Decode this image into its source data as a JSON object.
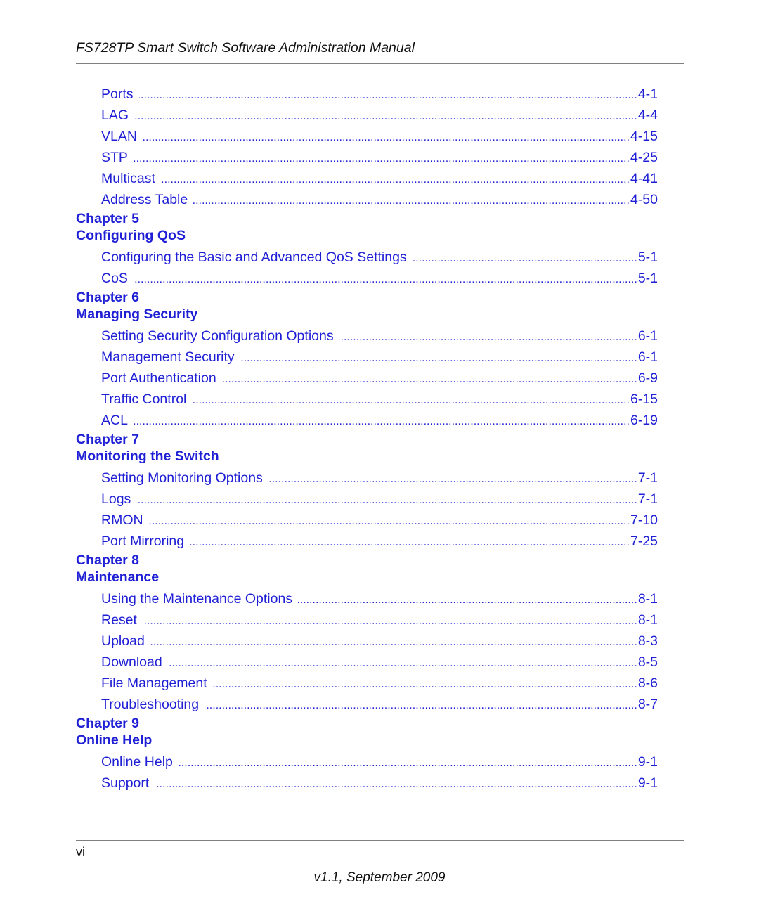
{
  "header": {
    "title": "FS728TP Smart Switch Software Administration Manual"
  },
  "toc": {
    "pre_entries": [
      {
        "label": "Ports",
        "page": "4-1"
      },
      {
        "label": "LAG",
        "page": "4-4"
      },
      {
        "label": "VLAN",
        "page": "4-15"
      },
      {
        "label": "STP",
        "page": "4-25"
      },
      {
        "label": "Multicast",
        "page": "4-41"
      },
      {
        "label": "Address Table",
        "page": "4-50"
      }
    ],
    "chapters": [
      {
        "number": "Chapter 5",
        "title": "Configuring QoS",
        "entries": [
          {
            "label": "Configuring the Basic and Advanced QoS Settings",
            "page": "5-1"
          },
          {
            "label": "CoS",
            "page": "5-1"
          }
        ]
      },
      {
        "number": "Chapter 6",
        "title": "Managing Security",
        "entries": [
          {
            "label": "Setting Security Configuration Options",
            "page": "6-1"
          },
          {
            "label": "Management Security",
            "page": "6-1"
          },
          {
            "label": "Port Authentication",
            "page": "6-9"
          },
          {
            "label": "Traffic Control",
            "page": "6-15"
          },
          {
            "label": "ACL",
            "page": "6-19"
          }
        ]
      },
      {
        "number": "Chapter 7",
        "title": "Monitoring the Switch",
        "entries": [
          {
            "label": "Setting Monitoring Options",
            "page": "7-1"
          },
          {
            "label": "Logs",
            "page": "7-1"
          },
          {
            "label": "RMON",
            "page": "7-10"
          },
          {
            "label": "Port Mirroring",
            "page": "7-25"
          }
        ]
      },
      {
        "number": "Chapter 8",
        "title": "Maintenance",
        "entries": [
          {
            "label": "Using the Maintenance Options",
            "page": "8-1"
          },
          {
            "label": "Reset",
            "page": "8-1"
          },
          {
            "label": "Upload",
            "page": "8-3"
          },
          {
            "label": "Download",
            "page": "8-5"
          },
          {
            "label": "File Management",
            "page": "8-6"
          },
          {
            "label": "Troubleshooting",
            "page": "8-7"
          }
        ]
      },
      {
        "number": "Chapter 9",
        "title": "Online Help",
        "entries": [
          {
            "label": "Online Help",
            "page": "9-1"
          },
          {
            "label": "Support",
            "page": "9-1"
          }
        ]
      }
    ]
  },
  "footer": {
    "page_number": "vi",
    "version": "v1.1, September 2009"
  },
  "colors": {
    "link_blue": "#1f1fd6",
    "rule_gray": "#7f7f7f",
    "text": "#111111"
  }
}
